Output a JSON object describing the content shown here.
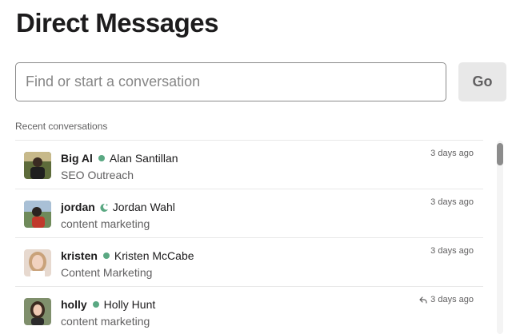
{
  "header": {
    "title": "Direct Messages"
  },
  "search": {
    "placeholder": "Find or start a conversation",
    "value": "",
    "go_label": "Go"
  },
  "recent": {
    "label": "Recent conversations",
    "items": [
      {
        "handle": "Big Al",
        "full_name": "Alan Santillan",
        "subtitle": "SEO Outreach",
        "time": "3 days ago",
        "status": "green-dot"
      },
      {
        "handle": "jordan",
        "full_name": "Jordan Wahl",
        "subtitle": "content marketing",
        "time": "3 days ago",
        "status": "moon-emoji"
      },
      {
        "handle": "kristen",
        "full_name": "Kristen McCabe",
        "subtitle": "Content Marketing",
        "time": "3 days ago",
        "status": "green-dot"
      },
      {
        "handle": "holly",
        "full_name": "Holly Hunt",
        "subtitle": "content marketing",
        "time": "3 days ago",
        "status": "green-dot",
        "reply_icon": "reply-arrow-icon"
      }
    ]
  },
  "colors": {
    "presence": "#5aa882",
    "text": "#1d1c1d",
    "muted": "#616061",
    "button_bg": "#e8e8e8"
  }
}
